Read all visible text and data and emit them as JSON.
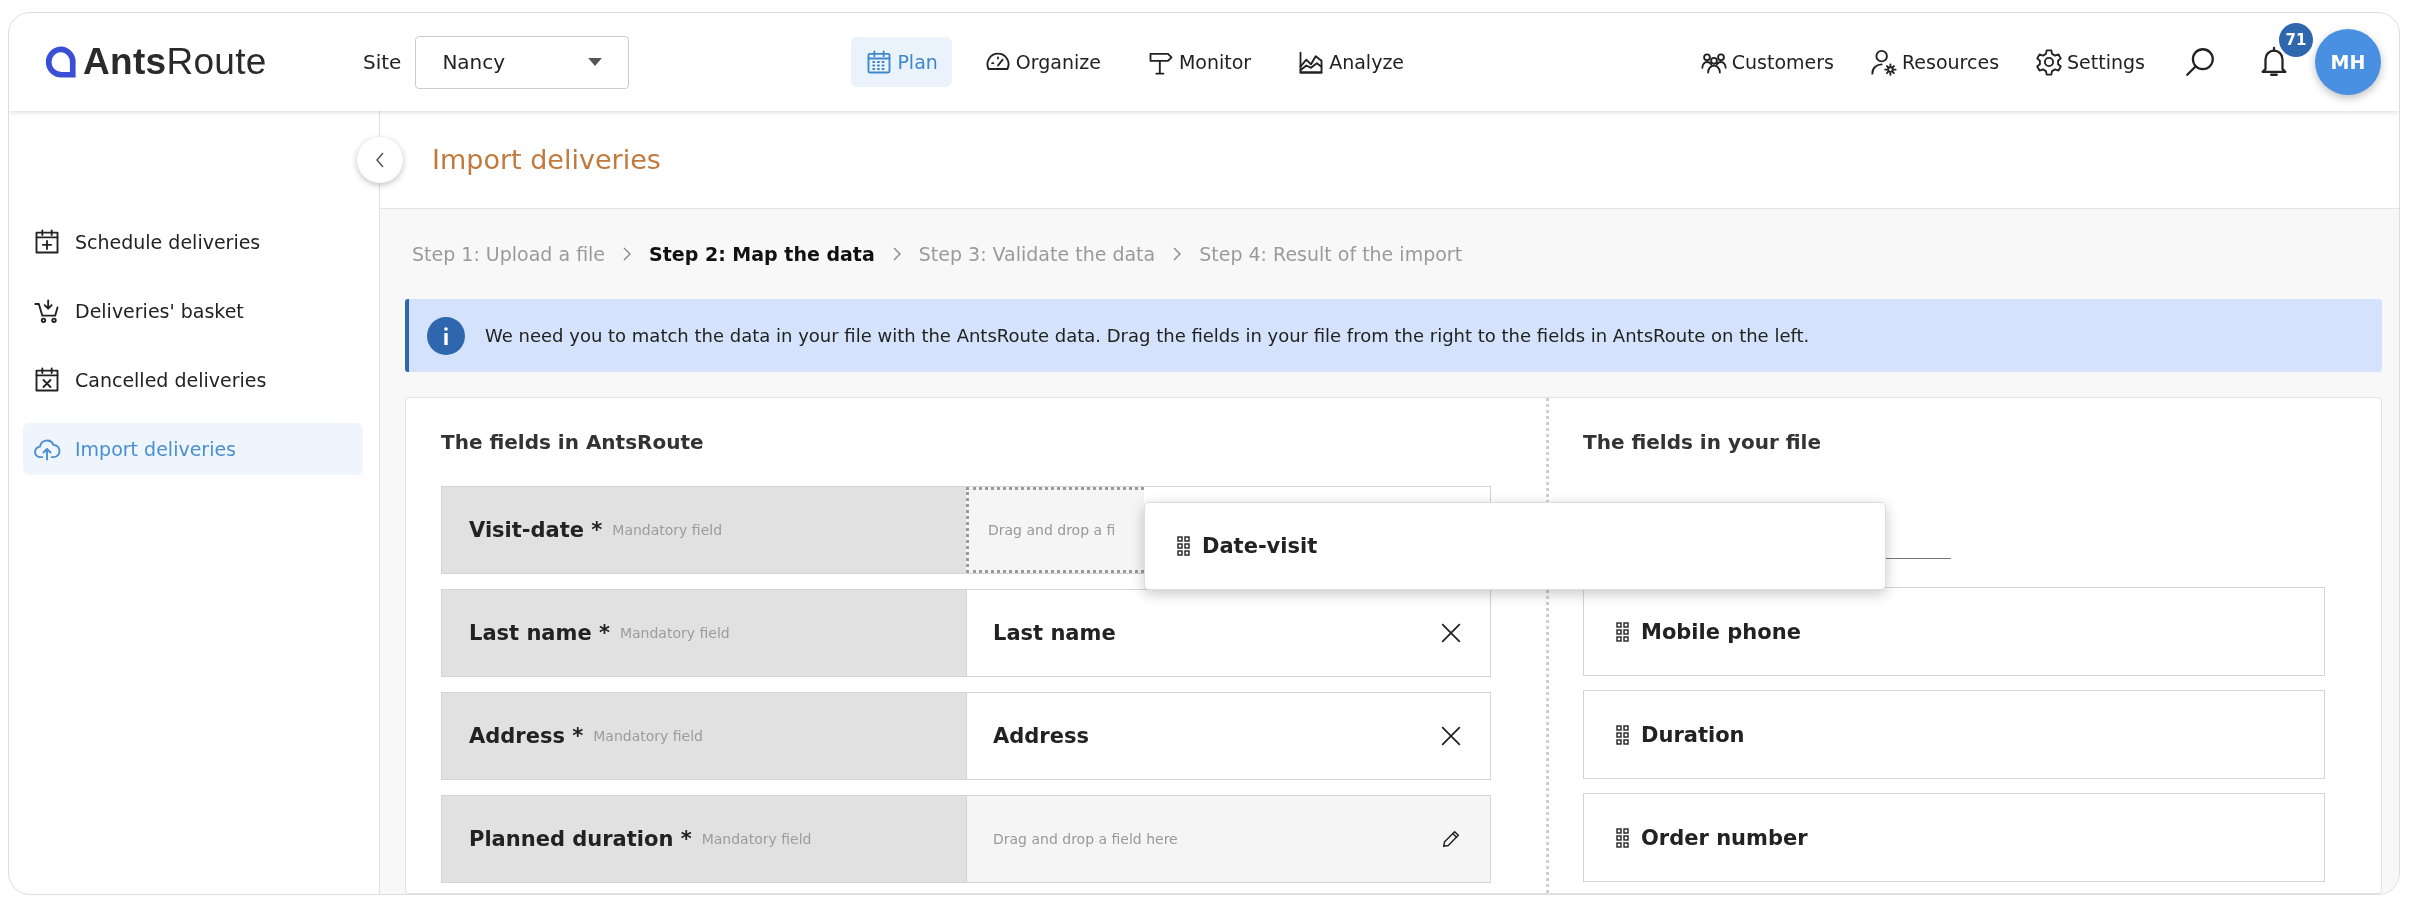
{
  "header": {
    "logo": "**Ants**Route",
    "site": {
      "label": "Site",
      "value": "Nancy"
    },
    "nav": [
      {
        "label": "Plan",
        "selected": true
      },
      {
        "label": "Organize",
        "selected": false
      },
      {
        "label": "Monitor",
        "selected": false
      },
      {
        "label": "Analyze",
        "selected": false
      }
    ],
    "tools": [
      {
        "label": "Customers"
      },
      {
        "label": "Resources"
      },
      {
        "label": "Settings"
      }
    ],
    "notifications": "71",
    "avatar": "MH"
  },
  "sidebar": {
    "items": [
      {
        "label": "Schedule deliveries",
        "selected": false
      },
      {
        "label": "Deliveries' basket",
        "selected": false
      },
      {
        "label": "Cancelled deliveries",
        "selected": false
      },
      {
        "label": "Import deliveries",
        "selected": true
      }
    ]
  },
  "page": {
    "title": "Import deliveries",
    "steps": [
      {
        "label": "Step 1: Upload a file",
        "selected": false
      },
      {
        "label": "Step 2: Map the data",
        "selected": true
      },
      {
        "label": "Step 3: Validate the data",
        "selected": false
      },
      {
        "label": "Step 4: Result of the import",
        "selected": false
      }
    ],
    "info": "We need you to match the data in your file with the AntsRoute data. Drag the fields in your file from the right to the fields in AntsRoute on the left.",
    "mapping": {
      "left_title": "The fields in AntsRoute",
      "right_title": "The fields in your file",
      "rows": [
        {
          "label": "Visit-date *",
          "hint": "Mandatory field",
          "kind": "hover",
          "placeholder": "Drag and drop a fi"
        },
        {
          "label": "Last name *",
          "hint": "Mandatory field",
          "kind": "mapped",
          "value": "Last name"
        },
        {
          "label": "Address *",
          "hint": "Mandatory field",
          "kind": "mapped",
          "value": "Address"
        },
        {
          "label": "Planned duration *",
          "hint": "Mandatory field",
          "kind": "empty",
          "placeholder": "Drag and drop a field here"
        }
      ],
      "dragged": "Date-visit",
      "file_fields": [
        "Mobile phone",
        "Duration",
        "Order number"
      ]
    }
  }
}
